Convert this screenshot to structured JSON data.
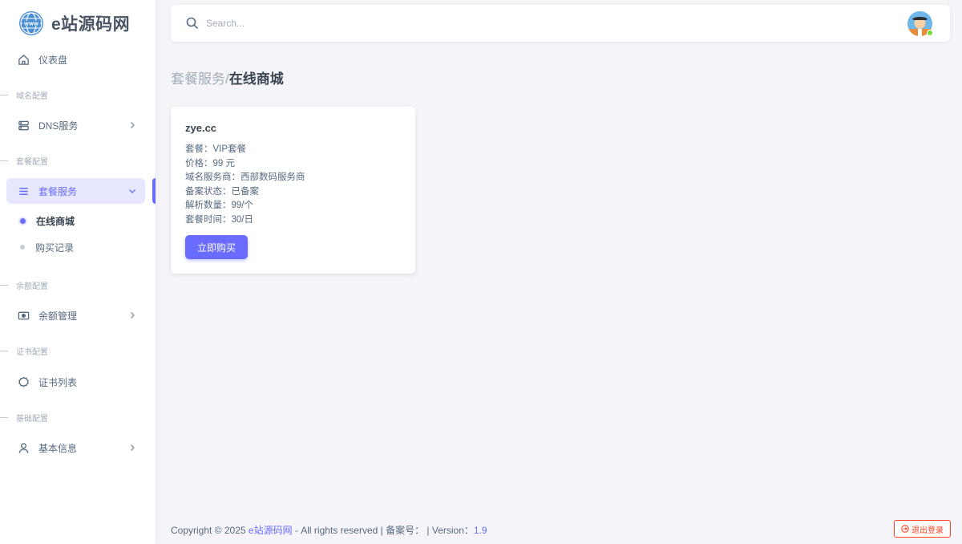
{
  "brand": {
    "name": "e站源码网"
  },
  "sidebar": {
    "dashboard": {
      "label": "仪表盘"
    },
    "sections": [
      {
        "header": "域名配置"
      },
      {
        "header": "套餐配置"
      },
      {
        "header": "余额配置"
      },
      {
        "header": "证书配置"
      },
      {
        "header": "基础配置"
      }
    ],
    "dns": {
      "label": "DNS服务"
    },
    "package": {
      "label": "套餐服务"
    },
    "package_sub": [
      {
        "label": "在线商城",
        "active": true
      },
      {
        "label": "购买记录",
        "active": false
      }
    ],
    "balance": {
      "label": "余额管理"
    },
    "certs": {
      "label": "证书列表"
    },
    "basic": {
      "label": "基本信息"
    }
  },
  "navbar": {
    "search_placeholder": "Search..."
  },
  "breadcrumb": {
    "parent": "套餐服务/",
    "current": "在线商城"
  },
  "card": {
    "title": "zye.cc",
    "lines": [
      "套餐：VIP套餐",
      "价格：99 元",
      "域名服务商：西部数码服务商",
      "备案状态：已备案",
      "解析数量：99/个",
      "套餐时间：30/日"
    ],
    "buy_label": "立即购买"
  },
  "footer": {
    "prefix": "Copyright © 2025 ",
    "site": "e站源码网",
    "middle": " - All rights reserved | 备案号：  | Version：",
    "version": "1.9"
  },
  "logout": {
    "label": "退出登录"
  },
  "colors": {
    "accent": "#696cff",
    "danger": "#ff3e1d",
    "online": "#71dd37"
  }
}
